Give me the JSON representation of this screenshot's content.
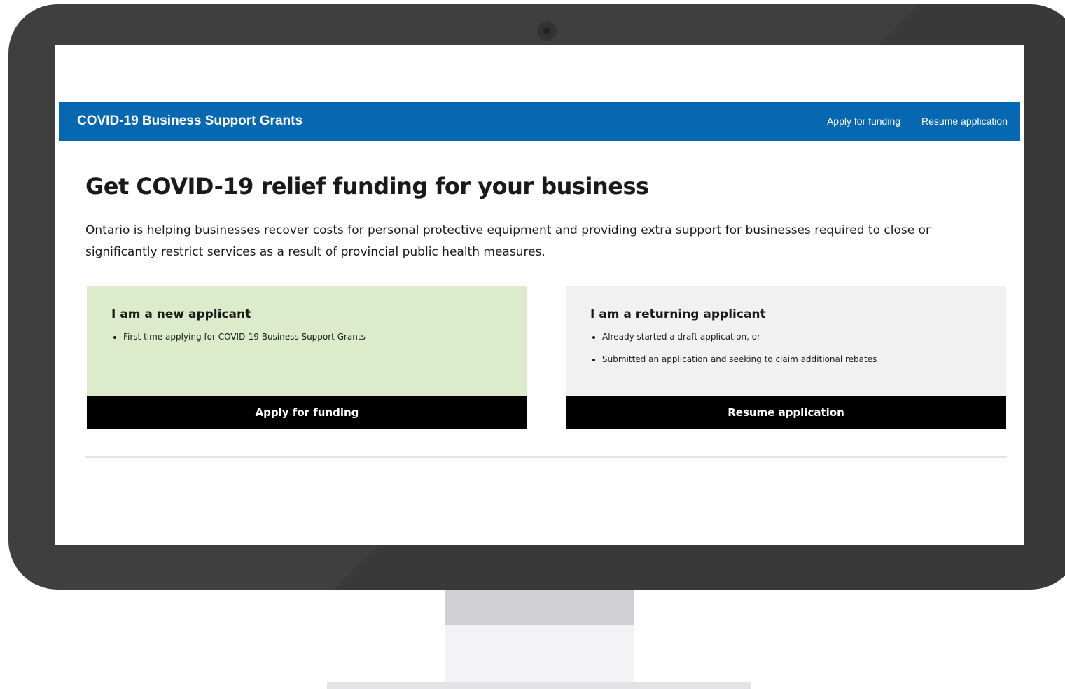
{
  "header": {
    "site_title": "COVID-19 Business Support Grants",
    "nav": [
      {
        "label": "Apply for funding"
      },
      {
        "label": "Resume application"
      }
    ]
  },
  "main": {
    "heading": "Get COVID-19 relief funding for your business",
    "intro": "Ontario is helping businesses recover costs for personal protective equipment and providing extra support for businesses required to close or significantly restrict services as a result of provincial public health measures."
  },
  "cards": {
    "new_applicant": {
      "heading": "I am a new applicant",
      "items": [
        "First time applying for COVID-19 Business Support Grants"
      ],
      "button_label": "Apply for funding",
      "background": "#dcebc9"
    },
    "returning_applicant": {
      "heading": "I am a returning applicant",
      "items": [
        "Already started a draft application, or",
        "Submitted an application and seeking to claim additional rebates"
      ],
      "button_label": "Resume application",
      "background": "#f1f1f1"
    }
  },
  "colors": {
    "header_blue": "#0568b0",
    "button_black": "#000000",
    "monitor_bezel": "#3f3f3f"
  }
}
